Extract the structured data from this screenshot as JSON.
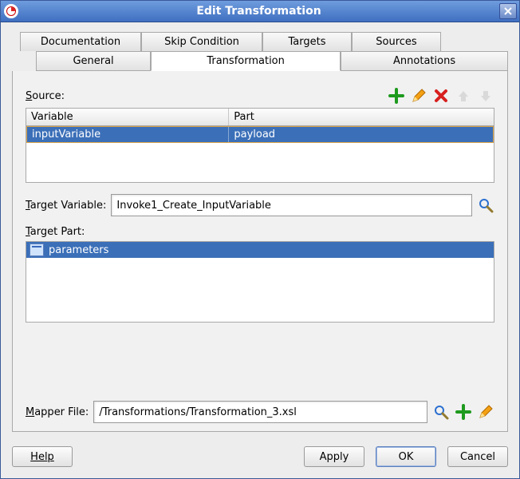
{
  "window": {
    "title": "Edit Transformation"
  },
  "tabs": {
    "row1": {
      "documentation": "Documentation",
      "skip_condition": "Skip Condition",
      "targets": "Targets",
      "sources": "Sources"
    },
    "row2": {
      "general": "General",
      "transformation": "Transformation",
      "annotations": "Annotations"
    }
  },
  "source": {
    "label": "Source:",
    "columns": {
      "variable": "Variable",
      "part": "Part"
    },
    "rows": [
      {
        "variable": "inputVariable",
        "part": "payload"
      }
    ]
  },
  "target_variable": {
    "label": "Target Variable:",
    "value": "Invoke1_Create_InputVariable"
  },
  "target_part": {
    "label": "Target Part:",
    "items": [
      {
        "label": "parameters"
      }
    ]
  },
  "mapper_file": {
    "label": "Mapper File:",
    "value": "/Transformations/Transformation_3.xsl"
  },
  "buttons": {
    "help": "Help",
    "apply": "Apply",
    "ok": "OK",
    "cancel": "Cancel"
  },
  "icons": {
    "add": "add-icon",
    "edit": "pencil-icon",
    "delete": "delete-icon",
    "up": "arrow-up-icon",
    "down": "arrow-down-icon",
    "browse": "magnifier-icon"
  }
}
